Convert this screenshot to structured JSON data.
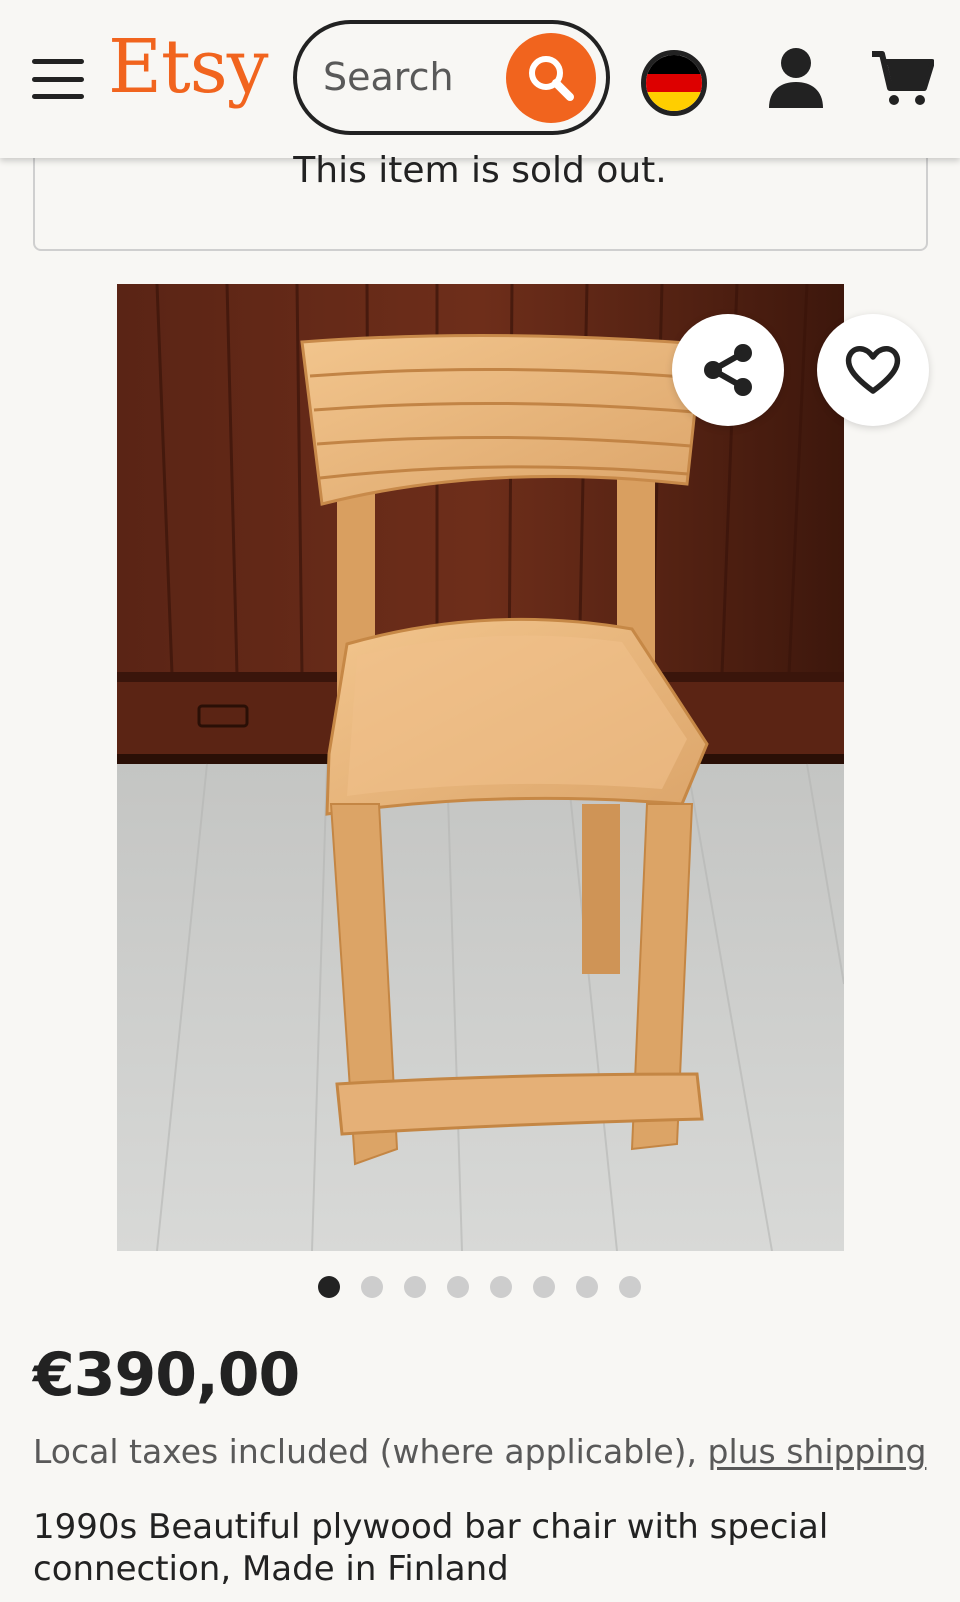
{
  "header": {
    "logo_text": "Etsy",
    "search_placeholder": "Search",
    "flag": {
      "colors": [
        "#000000",
        "#dd0000",
        "#ffce00"
      ],
      "icon": "germany-flag-icon"
    },
    "icons": [
      "hamburger-menu-icon",
      "search-icon",
      "user-icon",
      "shopping-cart-icon"
    ]
  },
  "notice": {
    "text": "This item is sold out."
  },
  "gallery": {
    "image_count": 8,
    "active_index": 0,
    "share_icon": "share-icon",
    "favorite_icon": "heart-icon"
  },
  "product": {
    "price": "€390,00",
    "tax_text": "Local taxes included (where applicable), ",
    "shipping_link": "plus shipping",
    "title": "1990s Beautiful plywood bar chair with special connection, Made in Finland"
  },
  "colors": {
    "brand": "#f1641e",
    "text": "#222222",
    "muted": "#595959",
    "background": "#f8f7f4"
  }
}
